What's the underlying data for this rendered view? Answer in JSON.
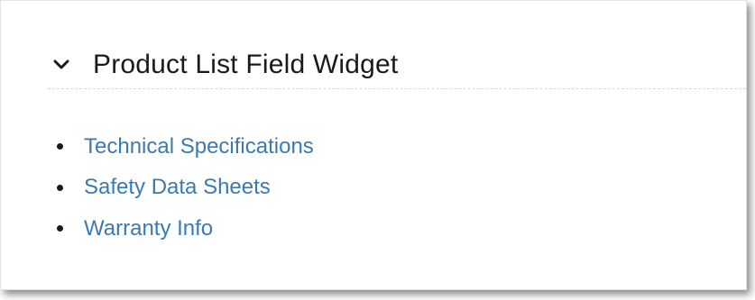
{
  "widget": {
    "title": "Product List Field Widget",
    "icon": "chevron-down-icon",
    "accent_color": "#3a7ab0",
    "links": [
      {
        "label": "Technical Specifications"
      },
      {
        "label": "Safety Data Sheets"
      },
      {
        "label": "Warranty Info"
      }
    ]
  }
}
